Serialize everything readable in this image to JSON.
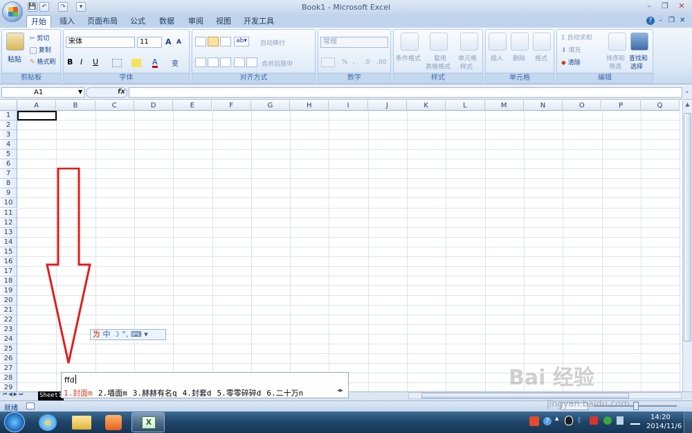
{
  "window": {
    "title": "Book1 - Microsoft Excel"
  },
  "quick_access": {
    "save": "💾",
    "undo": "↶",
    "redo": "↷",
    "more": "▾"
  },
  "tabs": [
    "开始",
    "插入",
    "页面布局",
    "公式",
    "数据",
    "审阅",
    "视图",
    "开发工具"
  ],
  "active_tab": "开始",
  "ribbon": {
    "clipboard": {
      "caption": "剪贴板",
      "paste": "粘贴",
      "cut": "剪切",
      "copy": "复制",
      "format_painter": "格式刷"
    },
    "font": {
      "caption": "字体",
      "name": "宋体",
      "size": "11",
      "bold": "B",
      "italic": "I",
      "underline": "U",
      "grow": "A",
      "shrink": "A",
      "font_color": "A",
      "wen": "变"
    },
    "alignment": {
      "caption": "对齐方式",
      "wrap": "自动换行",
      "merge": "合并后居中"
    },
    "number": {
      "caption": "数字",
      "format": "常规",
      "percent": "%",
      "comma": ",",
      "inc": ".0",
      "dec": ".00"
    },
    "styles": {
      "caption": "样式",
      "conditional": "条件格式",
      "as_table_1": "套用",
      "as_table_2": "表格格式",
      "cell_style_1": "单元格",
      "cell_style_2": "样式"
    },
    "cells": {
      "caption": "单元格",
      "insert": "插入",
      "delete": "删除",
      "format": "格式"
    },
    "editing": {
      "caption": "编辑",
      "autosum": "自动求和",
      "fill": "填充",
      "clear": "清除",
      "sort_1": "排序和",
      "sort_2": "筛选",
      "find_1": "查找和",
      "find_2": "选择"
    }
  },
  "formula_bar": {
    "name_box": "A1",
    "fx": "fx",
    "value": ""
  },
  "columns": [
    "A",
    "B",
    "C",
    "D",
    "E",
    "F",
    "G",
    "H",
    "I",
    "J",
    "K",
    "L",
    "M",
    "N",
    "O",
    "P",
    "Q"
  ],
  "rows": [
    "1",
    "2",
    "3",
    "4",
    "5",
    "6",
    "7",
    "8",
    "9",
    "10",
    "11",
    "12",
    "13",
    "14",
    "15",
    "16",
    "17",
    "18",
    "19",
    "20",
    "21",
    "22",
    "23",
    "24",
    "25",
    "26",
    "27",
    "28",
    "29"
  ],
  "sheet_tab": "Sheet1",
  "status": {
    "ready": "就绪"
  },
  "ime": {
    "composition": "ffd",
    "candidates": [
      "1.封面m",
      "2.墙面m",
      "3.赫赫有名q",
      "4.封套d",
      "5.零零碎碎d",
      "6.二十万n"
    ],
    "toolbar": "中 ☽ °, ⌨ ▾",
    "toolbar_logo": "ㄌ"
  },
  "taskbar": {
    "time": "14:20",
    "date": "2014/11/6"
  },
  "watermark": {
    "main": "Bai 经验",
    "sub": "jingyan.baidu.com"
  },
  "colors": {
    "annotation_arrow": "#e31b1b",
    "ribbon_bg": "#dbe8f6",
    "ime_selected": "#d23c1f"
  }
}
